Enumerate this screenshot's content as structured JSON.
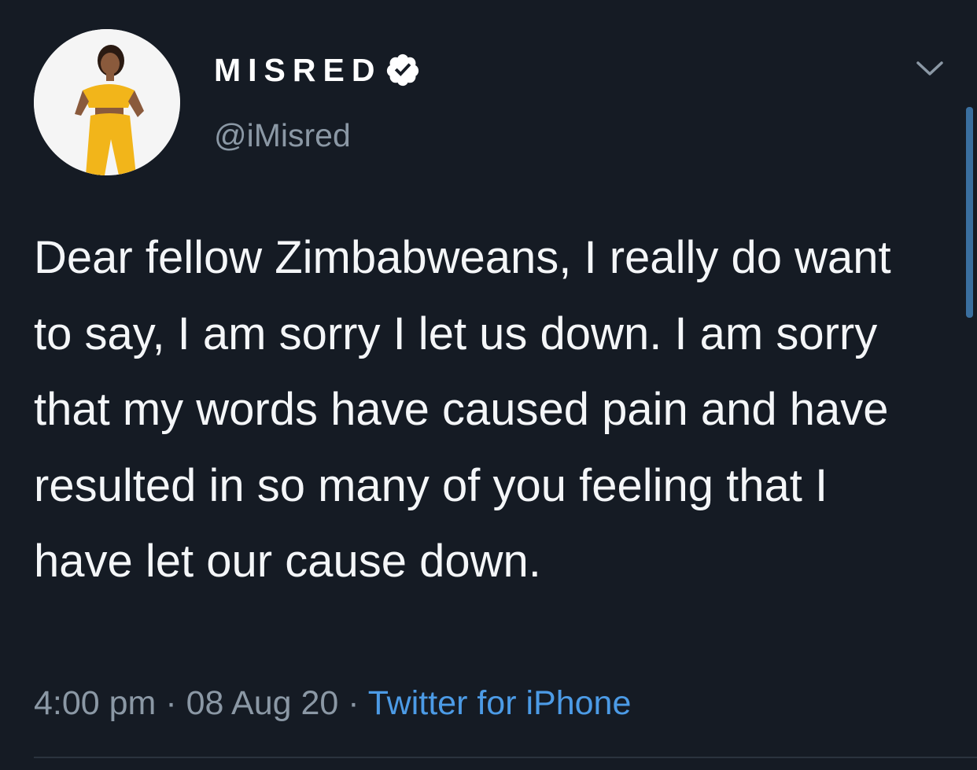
{
  "tweet": {
    "display_name": "MISRED",
    "handle": "@iMisred",
    "text": "Dear fellow Zimbabweans, I really do want to say, I am sorry I let us down. I am sorry that my words have caused pain and have resulted in so many of you feeling that I have let our cause down.",
    "time": "4:00 pm",
    "separator": "·",
    "date": "08 Aug 20",
    "source": "Twitter for iPhone"
  },
  "icons": {
    "verified": "verified-badge-icon",
    "caret": "chevron-down-icon",
    "avatar": "profile-photo"
  },
  "colors": {
    "background": "#151b24",
    "text": "#f4f6f8",
    "secondary_text": "#8b98a5",
    "link": "#4c9be6",
    "badge": "#ffffff"
  }
}
